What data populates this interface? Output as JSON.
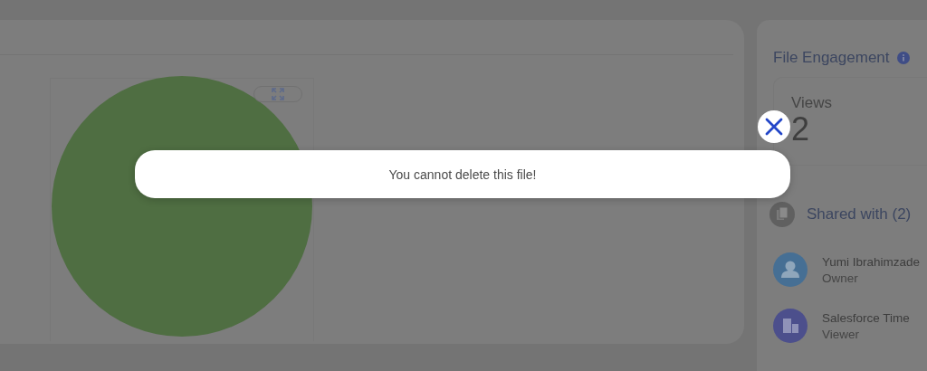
{
  "engagement": {
    "title": "File Engagement",
    "views_label": "Views",
    "views_value": "2"
  },
  "shared": {
    "title": "Shared with (2)",
    "people": [
      {
        "name": "Yumi Ibrahimzade",
        "role": "Owner",
        "kind": "person"
      },
      {
        "name": "Salesforce Time",
        "role": "Viewer",
        "kind": "organization"
      }
    ]
  },
  "alert": {
    "message": "You cannot delete this file!"
  }
}
